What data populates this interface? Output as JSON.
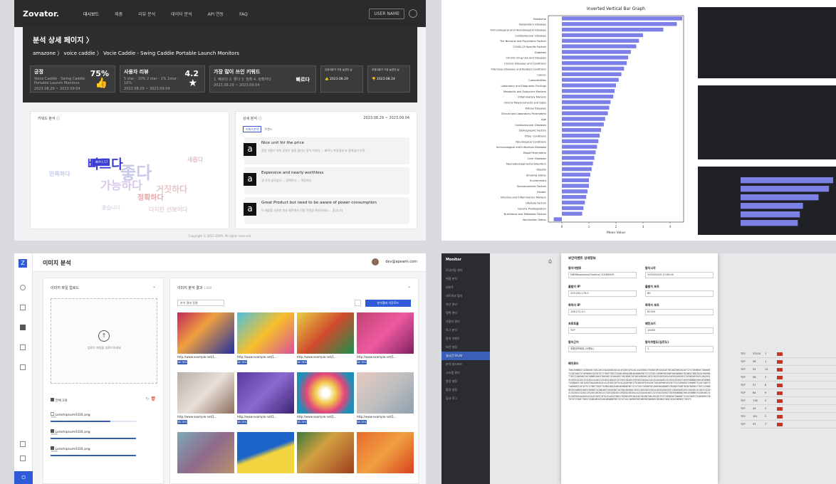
{
  "q1": {
    "logo": "Zovator.",
    "nav": [
      "대시보드",
      "제품",
      "리뷰 분석",
      "데이터 분석",
      "API 연동",
      "FAQ"
    ],
    "user": "USER NAME",
    "title": "분석 상세 페이지 〉",
    "crumb": "amazone 〉 voice caddie 〉 Vocie Caddie - Swing Caddie Portable Launch Monitors",
    "stats": [
      {
        "title": "긍정",
        "value": "75%",
        "sub": "Voice Caddie - Swing Caddie Portable Launch Monitors",
        "date": "2023.08.29 ~ 2023.09.04"
      },
      {
        "title": "사용자 리뷰",
        "value": "4.2",
        "sub": "5 star - 10%   2 star - 1%   1star - 10%",
        "date": "2023.08.29 ~ 2023.09.04"
      },
      {
        "title": "가장 많이 쓰인 키워드",
        "value": "빠르다",
        "sub": "1. 빠르다  2. 좋다  3. 정확  4. 정확하다",
        "date": "2023.08.29 ~ 2023.09.04"
      },
      {
        "title": "긍정리뷰가 가장 높았던 날",
        "value": "2023.08.29"
      },
      {
        "title": "부정리뷰가 가장 높았던 날",
        "value": "2023.08.24"
      }
    ],
    "keyword_title": "키워드 분석",
    "cloud": [
      "빠르다",
      "좋다",
      "가능하다",
      "정확하다",
      "거짓하다",
      "만족하다",
      "다지인 선보이다",
      "좋습니다",
      "새롭다"
    ],
    "tooltip": "빠르다 17",
    "detail_title": "상세 분석",
    "detail_date": "2023.08.29 ~ 2023.09.04",
    "tabs": [
      "키워드분석",
      "트렌드"
    ],
    "reviews": [
      {
        "title": "Nice unit for the price",
        "body": "정말 사용이 쉬워 공항이 설정 클리나 동작 자체가 ... 빠르다 측정결과 또 쓸데없이 만족"
      },
      {
        "title": "Expensive and nearly worthless",
        "body": "생 가격 쓸모없다 ... 정확하다 ... 복잡하다"
      },
      {
        "title": "Great Product but need to be aware of power consumption",
        "body": "이 제품을 사용한 방송 예전에서 전원 전원을 확인하세요 ... 좋습니다"
      }
    ],
    "footer": "Copyright © 2023 ZOVA. All rights reserved."
  },
  "q2": {
    "chart_title": "Inverted Vertical Bar Graph",
    "colors": {
      "bar": "#7b7fe6"
    },
    "chart_data": {
      "type": "bar",
      "title": "Inverted Vertical Bar Graph",
      "xlabel": "Mean Value",
      "ylabel": "",
      "xlim": [
        -0.5,
        4.5
      ],
      "categories": [
        "Headache",
        "Respiratory Diseases",
        "Immunological and Hematological Diseases",
        "Cardiovascular Diseases",
        "The Nervous and Psychiatric Factors",
        "COVID-19 Specific Factors",
        "Diabetes",
        "Chronic Drug Use and Diseases",
        "Chronic Diseases and Conditions",
        "Infectious Diseases and Related Conditions",
        "Cancer",
        "Comorbidities",
        "Laboratory and Diagnostic Findings",
        "Metabolic and Endocrine Markers",
        "Inflammatory Markers",
        "Clinical Measurements and Signs",
        "Kidney Diseases",
        "Clinical and Laboratory Parameters",
        "Age",
        "Cardiovascular Diseases",
        "Demographic Factors",
        "Other Conditions",
        "Neurological Conditions",
        "Immunological and Infectious Diseases",
        "Blood Parameters",
        "Liver Diseases",
        "Neurodevelopmental Disorders",
        "Obesity",
        "Smoking Status",
        "Environment",
        "Socioeconomic Factors",
        "Gender",
        "Infective and Inflammatory Markers",
        "Lifestyle Factors",
        "Genetic Predisposition",
        "Nutritional and Metabolic Factors",
        "Vaccination Status"
      ],
      "values": [
        4.45,
        4.25,
        3.75,
        3.0,
        2.85,
        2.75,
        2.55,
        2.45,
        2.4,
        2.3,
        2.2,
        2.1,
        2.0,
        1.95,
        1.9,
        1.8,
        1.75,
        1.7,
        1.6,
        1.55,
        1.45,
        1.4,
        1.35,
        1.3,
        1.25,
        1.2,
        1.15,
        1.1,
        1.05,
        1.0,
        1.0,
        0.95,
        0.9,
        0.85,
        0.8,
        0.75,
        -0.3
      ],
      "xticks": [
        "0",
        "1",
        "2",
        "3",
        "4"
      ]
    }
  },
  "q3": {
    "title": "이미지 분석",
    "user": "dev@apewm.com",
    "upload_title": "이미지 파일 업로드",
    "upload_hint": "업로드 파일을 업로드하세요.",
    "result_title": "이미지 분석 결과",
    "result_count": "1,400",
    "filter": "분석 결과 정렬",
    "analyze_button": "분석결과 다운로드",
    "files": [
      {
        "name": "Loremipsum4334.png",
        "progress": "70%",
        "ratio": 0.7
      },
      {
        "name": "Loremipsum4334.png",
        "progress": "100%",
        "ratio": 1.0
      },
      {
        "name": "Loremipsum4334.png",
        "progress": "100%",
        "ratio": 1.0
      }
    ],
    "count_label": "전체 3개",
    "thumbs": [
      {
        "url": "http://www.example.net/1...",
        "tag": "88.78%",
        "color": "linear-gradient(135deg,#c0275a,#f0a040 40%,#2030a0)"
      },
      {
        "url": "http://www.example.net/1...",
        "tag": "88.78%",
        "color": "linear-gradient(135deg,#4bc0e0,#f7c02b 50%,#d84f9a)"
      },
      {
        "url": "http://www.example.net/1...",
        "tag": "88.78%",
        "color": "linear-gradient(135deg,#e8cf40,#cf4b2e 50%,#1d8f4c)"
      },
      {
        "url": "http://www.example.net/1...",
        "tag": "88.78%",
        "color": "linear-gradient(135deg,#c04070,#ee5ba0 50%,#802060)"
      },
      {
        "url": "http://www.example.net/1...",
        "tag": "88.78%",
        "color": "linear-gradient(135deg,#b8b0a8,#e8e0d8 50%,#8c6e5e)"
      },
      {
        "url": "http://www.example.net/1...",
        "tag": "88.78%",
        "color": "linear-gradient(135deg,#5a3aa0,#8a6ad0 50%,#3d2370)"
      },
      {
        "url": "http://www.example.net/1...",
        "tag": "88.78%",
        "color": "radial-gradient(circle,#ffffff 10%,#f2c94c 30%,#e3457b 55%,#1f8fb8 80%)"
      },
      {
        "url": "http://www.example.net/1...",
        "tag": "88.78%",
        "color": "linear-gradient(135deg,#e6c9c0,#c0c0c0 50%,#8fa0b0)"
      },
      {
        "url": "",
        "tag": "",
        "color": "linear-gradient(135deg,#7fa8b8,#8e6a8a 50%,#b89070)"
      },
      {
        "url": "",
        "tag": "",
        "color": "linear-gradient(160deg,#1d64c8 45%,#f2d440 55%)"
      },
      {
        "url": "",
        "tag": "",
        "color": "linear-gradient(135deg,#3c7a3c,#d0a040 40%,#a04020)"
      },
      {
        "url": "",
        "tag": "",
        "color": "linear-gradient(135deg,#e86a2e,#f0a040 50%,#d84020)"
      }
    ]
  },
  "q4": {
    "brand": "Monitor",
    "menu": [
      "모니터링 센터",
      "위협 분석",
      "리포트",
      "네트워크 탐지",
      "자산 관리",
      "정책 관리",
      "사용자 관리",
      "로그 분석",
      "탐지 이벤트",
      "보안 설정",
      "실시간 모니터",
      "분석 대시보드",
      "시스템 관리",
      "알림 설정",
      "환경 설정",
      "감사 로그"
    ],
    "modal_title": "보안이벤트 상세정보",
    "fields": [
      {
        "label": "탐지이벤트",
        "value": "DNSResolution(Oneline) 20180909"
      },
      {
        "label": "탐지시각",
        "value": "2023/03/20 13:00:00"
      },
      {
        "label": "출발지 IP",
        "value": "203.250.179.0"
      },
      {
        "label": "출발지 포트",
        "value": "80"
      },
      {
        "label": "목적지 IP",
        "value": "128.172.0.1"
      },
      {
        "label": "목적지 포트",
        "value": "62345"
      },
      {
        "label": "프로토콜",
        "value": "TCP"
      },
      {
        "label": "패킷크기",
        "value": "15000"
      },
      {
        "label": "탐지근거",
        "value": "위협정보매칭 (이벤트)"
      },
      {
        "label": "탐지위험도(심각도)",
        "value": "1"
      }
    ],
    "payload_label": "페이로드",
    "payload": "7061636B65742D6461746120313A2048454C4C4F20574F524C4420706179206C6F61642073616D706C6520737472696E6720666F722074657374696E6720707572706F73657320616E642064656D6F6E7374726174696F6E206F66206865782064756D702076696577657220696E20746865206576656E742064657461696C2070616E656C20312032203320342035203620372038203920313020313120313220313320313420313520313620313720313820313920323020414243444546313233343536373839300D0A7061636B65742D6461746120323A2048454C4C4F20574F524C4420706179206C6F61642073616D706C6520737472696E6720666F722074657374696E6720707572706F73657320616E642064656D6F6E7374726174696F6E206F66206865782064756D702076696577657220696E20746865206576656E742064657461696C2070616E656C20312032203320342035203620372038203920313020313120313220313320313420313520313620313720313820313920323020414243444546313233343536373839300D0A7061636B65742D6461746120333A2048454C4C4F20574F524C4420706179206C6F61642073616D706C6520737472696E6720666F722074657374696E6720707572706F73657320616E642064656D6F6E7374726174696F6E206F66206865782064756D7020766965776572",
    "table_rows": [
      [
        "TCP",
        "32524",
        "1",
        "high"
      ],
      [
        "TCP",
        "58",
        "1",
        "high"
      ],
      [
        "TCP",
        "55",
        "12",
        "high"
      ],
      [
        "TCP",
        "56",
        "3",
        "high"
      ],
      [
        "TCP",
        "57",
        "8",
        "high"
      ],
      [
        "TCP",
        "84",
        "9",
        "high"
      ],
      [
        "TCP",
        "118",
        "5",
        "high"
      ],
      [
        "TCP",
        "44",
        "3",
        "high"
      ],
      [
        "TCP",
        "101",
        "2",
        "high"
      ],
      [
        "TCP",
        "93",
        "7",
        "high"
      ]
    ]
  }
}
